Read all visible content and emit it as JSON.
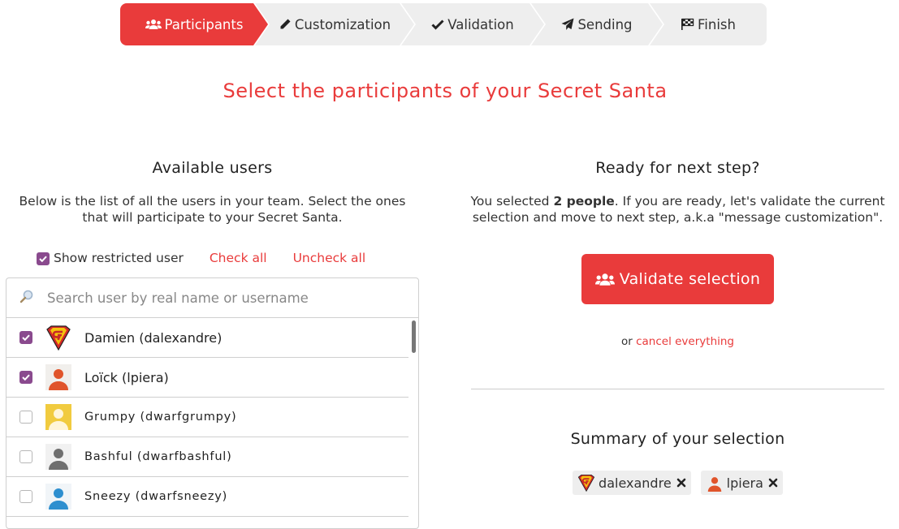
{
  "stepper": {
    "steps": [
      {
        "label": "Participants",
        "icon": "users-icon",
        "active": true
      },
      {
        "label": "Customization",
        "icon": "pencil-icon",
        "active": false
      },
      {
        "label": "Validation",
        "icon": "check-icon",
        "active": false
      },
      {
        "label": "Sending",
        "icon": "paper-plane-icon",
        "active": false
      },
      {
        "label": "Finish",
        "icon": "checkered-flag-icon",
        "active": false
      }
    ]
  },
  "page": {
    "title": "Select the participants of your Secret Santa"
  },
  "available": {
    "title": "Available users",
    "description": "Below is the list of all the users in your team. Select the ones that will participate to your Secret Santa.",
    "show_restricted_label": "Show restricted user",
    "show_restricted_checked": true,
    "check_all": "Check all",
    "uncheck_all": "Uncheck all",
    "search_placeholder": "Search user by real name or username",
    "users": [
      {
        "name": "Damien (dalexandre)",
        "checked": true,
        "avatar": "superhero-logo-avatar"
      },
      {
        "name": "Loïck (lpiera)",
        "checked": true,
        "avatar": "orange-person-avatar"
      },
      {
        "name": "Grumpy (dwarfgrumpy)",
        "checked": false,
        "avatar": "yellow-person-avatar"
      },
      {
        "name": "Bashful (dwarfbashful)",
        "checked": false,
        "avatar": "gray-person-avatar"
      },
      {
        "name": "Sneezy (dwarfsneezy)",
        "checked": false,
        "avatar": "blue-person-avatar"
      }
    ]
  },
  "next": {
    "title": "Ready for next step?",
    "selected_prefix": "You selected ",
    "selected_count": "2 people",
    "selected_suffix": ". If you are ready, let's validate the current selection and move to next step, a.k.a \"message customization\".",
    "validate_label": "Validate selection",
    "or_text": "or ",
    "cancel_label": "cancel everything"
  },
  "summary": {
    "title": "Summary of your selection",
    "tags": [
      {
        "label": "dalexandre",
        "avatar": "superhero-logo-avatar"
      },
      {
        "label": "lpiera",
        "avatar": "orange-person-avatar"
      }
    ]
  },
  "colors": {
    "accent": "#e93b3b",
    "checkbox": "#8a4a8e",
    "step_inactive": "#eeeeee"
  }
}
